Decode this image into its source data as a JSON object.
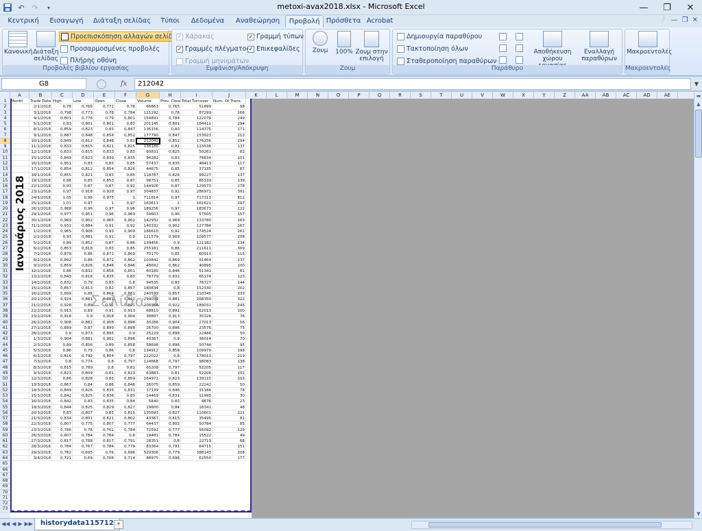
{
  "app": {
    "title": "metoxi-avax2018.xlsx - Microsoft Excel",
    "quick_access": [
      "save-icon",
      "undo-icon",
      "redo-icon",
      "customize-icon"
    ],
    "window_buttons": [
      "minimize-icon",
      "restore-icon",
      "close-icon"
    ]
  },
  "ribbon": {
    "tabs": [
      {
        "label": "Κεντρική",
        "active": false
      },
      {
        "label": "Εισαγωγή",
        "active": false
      },
      {
        "label": "Διάταξη σελίδας",
        "active": false
      },
      {
        "label": "Τύποι",
        "active": false
      },
      {
        "label": "Δεδομένα",
        "active": false
      },
      {
        "label": "Αναθεώρηση",
        "active": false
      },
      {
        "label": "Προβολή",
        "active": true
      },
      {
        "label": "Πρόσθετα",
        "active": false
      },
      {
        "label": "Acrobat",
        "active": false
      }
    ],
    "groups": {
      "workbook_views": {
        "label": "Προβολές βιβλίου εργασίας",
        "normal": "Κανονική",
        "page_layout": "Διάταξη σελίδας",
        "page_break_preview": "Προεπισκόπηση αλλαγών σελίδας",
        "custom_views": "Προσαρμοσμένες προβολές",
        "full_screen": "Πλήρης οθόνη"
      },
      "show_hide": {
        "label": "Εμφάνιση/Απόκρυψη",
        "ruler": "Χάρακας",
        "gridlines": "Γραμμές πλέγματος",
        "message_bar": "Γραμμή μηνυμάτων",
        "formula_bar": "Γραμμή τύπων",
        "headings": "Επικεφαλίδες"
      },
      "zoom": {
        "label": "Ζουμ",
        "zoom": "Ζουμ",
        "hundred": "100%",
        "zoom_selection": "Ζουμ στην επιλογή"
      },
      "window": {
        "label": "Παράθυρο",
        "new_window": "Δημιουργία παραθύρου",
        "arrange_all": "Τακτοποίηση όλων",
        "freeze_panes": "Σταθεροποίηση παραθύρων",
        "save_workspace": "Αποθήκευση χώρου εργασίας",
        "switch_windows": "Εναλλαγή παραθύρων"
      },
      "macros": {
        "label": "Μακροεντολές",
        "macros": "Μακροεντολές"
      }
    }
  },
  "formula_bar": {
    "name_box": "G8",
    "fx": "fx",
    "value": "212042"
  },
  "sheet": {
    "vertical_label": "Ιανουάριος 2018",
    "watermark": "Σελίδα 1",
    "tab_name": "historydata115712",
    "selected_cell": "G8",
    "column_letters": [
      "A",
      "B",
      "C",
      "D",
      "E",
      "F",
      "G",
      "H",
      "I",
      "J",
      "K",
      "L",
      "M",
      "N",
      "O",
      "P",
      "Q",
      "R",
      "S",
      "T",
      "U",
      "V",
      "W",
      "X",
      "Y",
      "Z",
      "AA",
      "AB",
      "AC",
      "AD",
      "AE"
    ],
    "headers": [
      "Month",
      "Trade Date",
      "High",
      "Low",
      "Open",
      "Close",
      "Volume",
      "Prev. Close",
      "Total Turnover",
      "Num. Of Trans."
    ],
    "rows": [
      [
        "",
        "2/1/2018",
        "0,78",
        "0,766",
        "0,772",
        "0,78",
        "66863",
        "0,765",
        "51899",
        "98"
      ],
      [
        "",
        "3/1/2018",
        "0,798",
        "0,773",
        "0,78",
        "0,784",
        "111292",
        "0,78",
        "87299",
        "166"
      ],
      [
        "",
        "4/1/2018",
        "0,801",
        "0,778",
        "0,79",
        "0,801",
        "154891",
        "0,784",
        "122079",
        "249"
      ],
      [
        "",
        "5/1/2018",
        "0,83",
        "0,801",
        "0,801",
        "0,83",
        "201145",
        "0,801",
        "164411",
        "294"
      ],
      [
        "",
        "8/1/2018",
        "0,859",
        "0,823",
        "0,83",
        "0,847",
        "136156",
        "0,83",
        "114375",
        "171"
      ],
      [
        "",
        "9/1/2018",
        "0,887",
        "0,848",
        "0,856",
        "0,852",
        "177790",
        "0,847",
        "153923",
        "212"
      ],
      [
        "",
        "10/1/2018",
        "0,849",
        "0,812",
        "0,848",
        "0,82",
        "212042",
        "0,852",
        "176256",
        "294"
      ],
      [
        "",
        "11/1/2018",
        "0,833",
        "0,815",
        "0,821",
        "0,825",
        "138186",
        "0,82",
        "113536",
        "137"
      ],
      [
        "",
        "12/1/2018",
        "0,833",
        "0,815",
        "0,833",
        "0,83",
        "60831",
        "0,825",
        "50261",
        "82"
      ],
      [
        "",
        "15/1/2018",
        "0,849",
        "0,823",
        "0,839",
        "0,835",
        "94282",
        "0,83",
        "78834",
        "101"
      ],
      [
        "",
        "16/1/2018",
        "0,851",
        "0,83",
        "0,83",
        "0,85",
        "57437",
        "0,835",
        "48413",
        "117"
      ],
      [
        "",
        "17/1/2018",
        "0,854",
        "0,812",
        "0,854",
        "0,826",
        "44675",
        "0,85",
        "37135",
        "87"
      ],
      [
        "",
        "18/1/2018",
        "0,855",
        "0,821",
        "0,83",
        "0,85",
        "118787",
        "0,826",
        "99227",
        "137"
      ],
      [
        "",
        "19/1/2018",
        "0,88",
        "0,85",
        "0,853",
        "0,87",
        "98751",
        "0,85",
        "85339",
        "139"
      ],
      [
        "",
        "22/1/2018",
        "0,93",
        "0,87",
        "0,87",
        "0,92",
        "144926",
        "0,87",
        "129573",
        "278"
      ],
      [
        "",
        "23/1/2018",
        "0,97",
        "0,918",
        "0,928",
        "0,97",
        "304837",
        "0,92",
        "286971",
        "391"
      ],
      [
        "",
        "24/1/2018",
        "1,05",
        "0,96",
        "0,975",
        "1",
        "711814",
        "0,97",
        "717313",
        "812"
      ],
      [
        "",
        "25/1/2018",
        "1,01",
        "0,97",
        "1",
        "0,97",
        "163611",
        "1",
        "161621",
        "297"
      ],
      [
        "",
        "26/1/2018",
        "0,988",
        "0,96",
        "0,97",
        "0,96",
        "189256",
        "0,97",
        "183673",
        "222"
      ],
      [
        "",
        "29/1/2018",
        "0,977",
        "0,951",
        "0,96",
        "0,969",
        "59603",
        "0,96",
        "57505",
        "157"
      ],
      [
        "",
        "30/1/2018",
        "0,969",
        "0,902",
        "0,965",
        "0,902",
        "142932",
        "0,969",
        "133780",
        "263"
      ],
      [
        "",
        "31/1/2018",
        "0,931",
        "0,884",
        "0,91",
        "0,92",
        "140332",
        "0,902",
        "127784",
        "267"
      ],
      [
        "",
        "1/2/2018",
        "0,965",
        "0,906",
        "0,93",
        "0,909",
        "186610",
        "0,92",
        "174524",
        "261"
      ],
      [
        "",
        "2/2/2018",
        "0,93",
        "0,881",
        "0,91",
        "0,9",
        "121579",
        "0,909",
        "109577",
        "208"
      ],
      [
        "",
        "5/2/2018",
        "0,89",
        "0,852",
        "0,87",
        "0,86",
        "139456",
        "0,9",
        "121182",
        "234"
      ],
      [
        "",
        "6/2/2018",
        "0,853",
        "0,818",
        "0,83",
        "0,85",
        "255181",
        "0,86",
        "211611",
        "309"
      ],
      [
        "",
        "7/2/2018",
        "0,879",
        "0,86",
        "0,872",
        "0,869",
        "70170",
        "0,85",
        "60913",
        "116"
      ],
      [
        "",
        "8/2/2018",
        "0,892",
        "0,86",
        "0,872",
        "0,862",
        "103842",
        "0,869",
        "91464",
        "137"
      ],
      [
        "",
        "9/2/2018",
        "0,859",
        "0,826",
        "0,846",
        "0,846",
        "48692",
        "0,862",
        "40895",
        "100"
      ],
      [
        "",
        "12/2/2018",
        "0,88",
        "0,832",
        "0,856",
        "0,851",
        "60180",
        "0,846",
        "51341",
        "81"
      ],
      [
        "",
        "13/2/2018",
        "0,843",
        "0,816",
        "0,835",
        "0,83",
        "78779",
        "0,832",
        "65174",
        "123"
      ],
      [
        "",
        "14/2/2018",
        "0,832",
        "0,79",
        "0,83",
        "0,8",
        "94535",
        "0,83",
        "76727",
        "144"
      ],
      [
        "",
        "15/2/2018",
        "0,857",
        "0,813",
        "0,82",
        "0,857",
        "180834",
        "0,8",
        "152330",
        "202"
      ],
      [
        "",
        "16/2/2018",
        "0,899",
        "0,86",
        "0,864",
        "0,881",
        "240599",
        "0,857",
        "210345",
        "333"
      ],
      [
        "",
        "20/2/2018",
        "0,924",
        "0,881",
        "0,881",
        "0,922",
        "294039",
        "0,881",
        "268350",
        "322"
      ],
      [
        "",
        "21/2/2018",
        "0,928",
        "0,89",
        "0,92",
        "0,891",
        "206954",
        "0,922",
        "189031",
        "245"
      ],
      [
        "",
        "22/2/2018",
        "0,913",
        "0,89",
        "0,91",
        "0,913",
        "68810",
        "0,891",
        "62013",
        "100"
      ],
      [
        "",
        "23/2/2018",
        "0,918",
        "0,9",
        "0,918",
        "0,904",
        "38897",
        "0,913",
        "35326",
        "76"
      ],
      [
        "",
        "26/2/2018",
        "0,908",
        "0,881",
        "0,908",
        "0,896",
        "30286",
        "0,904",
        "27013",
        "56"
      ],
      [
        "",
        "27/2/2018",
        "0,899",
        "0,87",
        "0,899",
        "0,898",
        "26700",
        "0,896",
        "23576",
        "75"
      ],
      [
        "",
        "28/2/2018",
        "0,9",
        "0,873",
        "0,895",
        "0,9",
        "25229",
        "0,898",
        "22486",
        "50"
      ],
      [
        "",
        "1/3/2018",
        "0,904",
        "0,881",
        "0,902",
        "0,896",
        "40367",
        "0,9",
        "36014",
        "70"
      ],
      [
        "",
        "2/3/2018",
        "0,89",
        "0,856",
        "0,89",
        "0,858",
        "58698",
        "0,896",
        "50744",
        "95"
      ],
      [
        "",
        "5/3/2018",
        "0,86",
        "0,79",
        "0,86",
        "0,8",
        "134912",
        "0,858",
        "109979",
        "198"
      ],
      [
        "",
        "6/3/2018",
        "0,816",
        "0,792",
        "0,804",
        "0,797",
        "222022",
        "0,8",
        "178013",
        "219"
      ],
      [
        "",
        "7/3/2018",
        "0,8",
        "0,774",
        "0,8",
        "0,797",
        "124668",
        "0,797",
        "98083",
        "138"
      ],
      [
        "",
        "8/3/2018",
        "0,815",
        "0,789",
        "0,8",
        "0,81",
        "65208",
        "0,797",
        "52205",
        "117"
      ],
      [
        "",
        "9/3/2018",
        "0,823",
        "0,809",
        "0,81",
        "0,823",
        "63883",
        "0,81",
        "52206",
        "102"
      ],
      [
        "",
        "12/3/2018",
        "0,86",
        "0,828",
        "0,83",
        "0,859",
        "164971",
        "0,823",
        "139110",
        "203"
      ],
      [
        "",
        "13/3/2018",
        "0,867",
        "0,84",
        "0,86",
        "0,846",
        "26075",
        "0,859",
        "22242",
        "50"
      ],
      [
        "",
        "14/3/2018",
        "0,849",
        "0,826",
        "0,835",
        "0,831",
        "37139",
        "0,846",
        "31186",
        "78"
      ],
      [
        "",
        "15/3/2018",
        "0,842",
        "0,825",
        "0,836",
        "0,83",
        "14469",
        "0,831",
        "11995",
        "30"
      ],
      [
        "",
        "16/3/2018",
        "0,842",
        "0,83",
        "0,835",
        "0,84",
        "5840",
        "0,83",
        "4876",
        "23"
      ],
      [
        "",
        "19/3/2018",
        "0,844",
        "0,825",
        "0,829",
        "0,827",
        "19600",
        "0,84",
        "16341",
        "48"
      ],
      [
        "",
        "20/3/2018",
        "0,83",
        "0,807",
        "0,83",
        "0,815",
        "135693",
        "0,827",
        "110601",
        "221"
      ],
      [
        "",
        "21/3/2018",
        "0,834",
        "0,801",
        "0,821",
        "0,802",
        "43367",
        "0,815",
        "35495",
        "81"
      ],
      [
        "",
        "22/3/2018",
        "0,807",
        "0,775",
        "0,807",
        "0,777",
        "64437",
        "0,802",
        "50784",
        "85"
      ],
      [
        "",
        "23/3/2018",
        "0,786",
        "0,76",
        "0,762",
        "0,784",
        "72592",
        "0,777",
        "56092",
        "129"
      ],
      [
        "",
        "26/3/2018",
        "0,807",
        "0,784",
        "0,784",
        "0,8",
        "19481",
        "0,784",
        "15522",
        "49"
      ],
      [
        "",
        "27/3/2018",
        "0,817",
        "0,788",
        "0,817",
        "0,791",
        "28351",
        "0,8",
        "22719",
        "68"
      ],
      [
        "",
        "28/3/2018",
        "0,784",
        "0,767",
        "0,784",
        "0,779",
        "83364",
        "0,791",
        "64715",
        "151"
      ],
      [
        "",
        "29/3/2018",
        "0,782",
        "0,695",
        "0,76",
        "0,696",
        "529306",
        "0,779",
        "388143",
        "208"
      ],
      [
        "",
        "3/4/2018",
        "0,721",
        "0,69",
        "0,706",
        "0,714",
        "88975",
        "0,696",
        "62550",
        "177"
      ]
    ]
  },
  "colors": {
    "page_break_line": "#2c2c96",
    "selected_header": "#f9d99f",
    "highlighted_button": "#f7c768"
  }
}
